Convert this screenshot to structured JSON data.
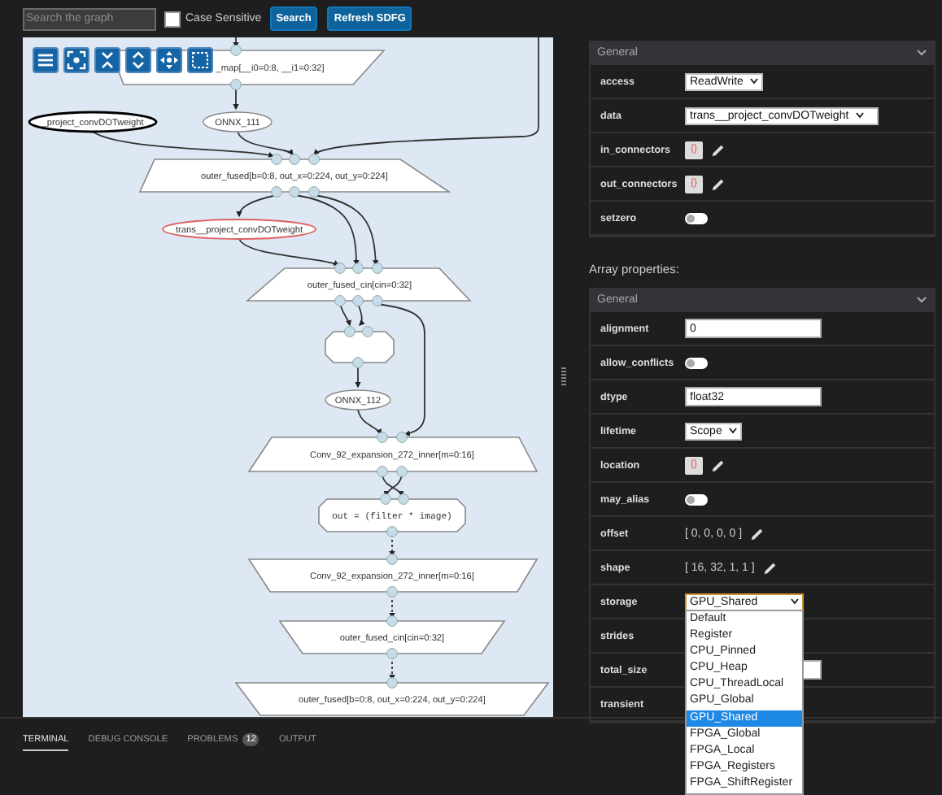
{
  "toolbar": {
    "search": {
      "placeholder": "Search the graph"
    },
    "case_sensitive": {
      "label": "Case Sensitive",
      "checked": false
    },
    "buttons": [
      "Search",
      "Refresh SDFG"
    ]
  },
  "graph": {
    "nodes": [
      {
        "kind": "map_exit",
        "label": "_map[__i0=0:8, __i1=0:32]"
      },
      {
        "kind": "access",
        "label": "_project_convDOTweight",
        "selected": true,
        "highlighted": false
      },
      {
        "kind": "access",
        "label": "ONNX_111",
        "selected": false,
        "highlighted": false
      },
      {
        "kind": "map_entry",
        "label": "outer_fused[b=0:8, out_x=0:224, out_y=0:224]"
      },
      {
        "kind": "access",
        "label": "trans__project_convDOTweight",
        "selected": false,
        "highlighted": true
      },
      {
        "kind": "map_entry",
        "label": "outer_fused_cin[cin=0:32]"
      },
      {
        "kind": "tasklet"
      },
      {
        "kind": "access",
        "label": "ONNX_112",
        "selected": false,
        "highlighted": false
      },
      {
        "kind": "map_entry",
        "label": "Conv_92_expansion_272_inner[m=0:16]"
      },
      {
        "kind": "tasklet",
        "label": "out = (filter * image)"
      },
      {
        "kind": "map_exit",
        "label": "Conv_92_expansion_272_inner[m=0:16]"
      },
      {
        "kind": "map_exit",
        "label": "outer_fused_cin[cin=0:32]"
      },
      {
        "kind": "map_exit",
        "label": "outer_fused[b=0:8, out_x=0:224, out_y=0:224]"
      }
    ]
  },
  "properties": [
    {
      "group_title": "General",
      "expanded": true,
      "rows": [
        {
          "kind": "select",
          "label": "access",
          "value": "ReadWrite"
        },
        {
          "kind": "select",
          "label": "data",
          "value": "trans__project_convDOTweight",
          "wide": true
        },
        {
          "kind": "dict",
          "label": "in_connectors",
          "value": "{}"
        },
        {
          "kind": "dict",
          "label": "out_connectors",
          "value": "{}"
        },
        {
          "kind": "toggle",
          "label": "setzero",
          "on": false
        }
      ]
    },
    {
      "heading": "Array properties:",
      "group_title": "General",
      "expanded": true,
      "rows": [
        {
          "kind": "input",
          "label": "alignment",
          "value": "0"
        },
        {
          "kind": "toggle",
          "label": "allow_conflicts",
          "on": false
        },
        {
          "kind": "input",
          "label": "dtype",
          "value": "float32"
        },
        {
          "kind": "select",
          "label": "lifetime",
          "value": "Scope"
        },
        {
          "kind": "dict",
          "label": "location",
          "value": "{}"
        },
        {
          "kind": "toggle",
          "label": "may_alias",
          "on": false
        },
        {
          "kind": "list",
          "label": "offset",
          "value": "[ 0, 0, 0, 0 ]"
        },
        {
          "kind": "list",
          "label": "shape",
          "value": "[ 16, 32, 1, 1 ]"
        },
        {
          "kind": "select",
          "label": "storage",
          "value": "GPU_Shared",
          "open": true,
          "options": [
            {
              "label": "Default",
              "selected": false
            },
            {
              "label": "Register",
              "selected": false
            },
            {
              "label": "CPU_Pinned",
              "selected": false
            },
            {
              "label": "CPU_Heap",
              "selected": false
            },
            {
              "label": "CPU_ThreadLocal",
              "selected": false
            },
            {
              "label": "GPU_Global",
              "selected": false
            },
            {
              "label": "GPU_Shared",
              "selected": true
            },
            {
              "label": "FPGA_Global",
              "selected": false
            },
            {
              "label": "FPGA_Local",
              "selected": false
            },
            {
              "label": "FPGA_Registers",
              "selected": false
            },
            {
              "label": "FPGA_ShiftRegister",
              "selected": false
            }
          ]
        },
        {
          "kind": "covered",
          "label": "strides"
        },
        {
          "kind": "input",
          "label": "total_size"
        },
        {
          "kind": "covered",
          "label": "transient"
        }
      ]
    }
  ],
  "panel_tabs": [
    {
      "label": "TERMINAL",
      "selected": true
    },
    {
      "label": "DEBUG CONSOLE",
      "selected": false
    },
    {
      "label": "PROBLEMS",
      "selected": false,
      "badge": "12"
    },
    {
      "label": "OUTPUT",
      "selected": false
    }
  ]
}
